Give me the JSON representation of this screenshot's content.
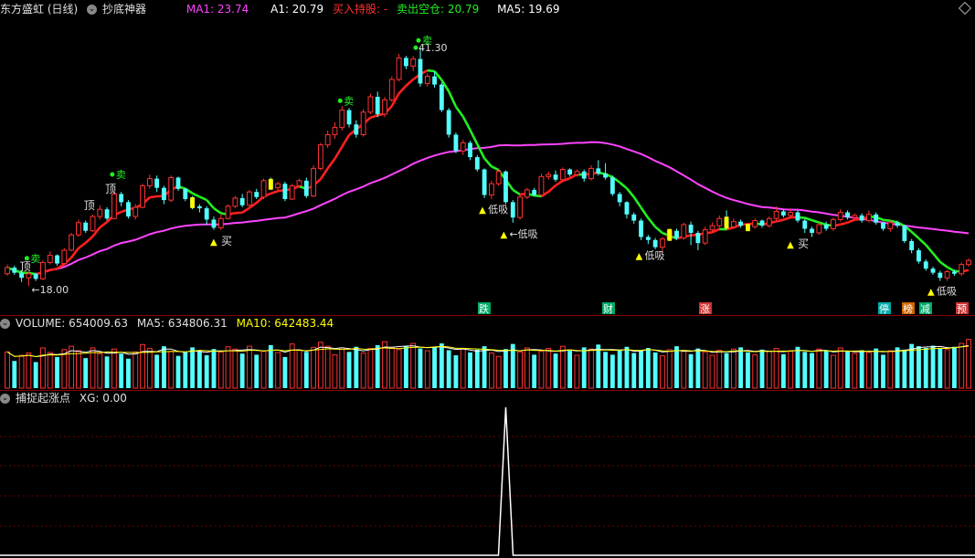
{
  "main_header": {
    "stock": "东方盛虹 (日线)",
    "indicator": "抄底神器",
    "ma1_label": "MA1: 23.74",
    "a1_label": "A1: 20.79",
    "buy_label": "买入持股: -",
    "sell_label": "卖出空仓: 20.79",
    "ma5_label": "MA5: 19.69"
  },
  "vol_header": {
    "volume": "VOLUME: 654009.63",
    "ma5": "MA5: 634806.31",
    "ma10": "MA10: 642483.44"
  },
  "xg_header": {
    "name": "捕捉起涨点",
    "xg": "XG: 0.00"
  },
  "colors": {
    "up": "#ff3232",
    "down": "#54ffff",
    "ma_magenta": "#ff44ff",
    "line_red": "#ff2020",
    "line_green": "#22ee22",
    "yellow": "#ffff00",
    "vol_ma5": "#ffffff",
    "vol_ma10": "#ffff00"
  },
  "labels": {
    "max": "41.30",
    "min": "18.00",
    "buy": "买",
    "sell": "卖",
    "top": "顶",
    "low_suck": "低吸"
  },
  "tags": [
    "跌",
    "财",
    "涨",
    "停",
    "榜",
    "减",
    "预"
  ],
  "chart_data": {
    "type": "candlestick",
    "price_range": [
      16.5,
      44
    ],
    "highest": 41.3,
    "lowest": 18.0,
    "candles": [
      [
        19.2,
        19.8,
        19.0,
        20.1
      ],
      [
        19.8,
        19.3,
        19.1,
        20.0
      ],
      [
        19.3,
        18.8,
        18.4,
        19.5
      ],
      [
        18.8,
        19.2,
        18.0,
        19.4
      ],
      [
        19.2,
        18.7,
        18.5,
        19.3
      ],
      [
        18.7,
        20.3,
        18.6,
        20.5
      ],
      [
        20.3,
        21.0,
        20.1,
        21.4
      ],
      [
        21.0,
        20.2,
        20.0,
        21.1
      ],
      [
        20.2,
        21.5,
        20.1,
        21.7
      ],
      [
        21.5,
        23.0,
        21.4,
        23.2
      ],
      [
        23.0,
        24.2,
        22.8,
        24.5
      ],
      [
        24.2,
        23.4,
        23.2,
        24.4
      ],
      [
        23.4,
        24.8,
        23.3,
        25.0
      ],
      [
        24.8,
        25.5,
        24.5,
        25.9
      ],
      [
        25.5,
        24.6,
        24.4,
        25.7
      ],
      [
        24.6,
        27.0,
        24.5,
        27.3
      ],
      [
        27.0,
        26.2,
        25.8,
        27.2
      ],
      [
        26.2,
        24.8,
        24.6,
        26.4
      ],
      [
        24.8,
        25.7,
        24.5,
        26.0
      ],
      [
        25.7,
        27.8,
        25.6,
        28.0
      ],
      [
        27.8,
        28.5,
        27.5,
        28.9
      ],
      [
        28.5,
        27.6,
        27.2,
        28.8
      ],
      [
        27.6,
        26.4,
        26.0,
        27.8
      ],
      [
        26.4,
        28.6,
        26.2,
        28.8
      ],
      [
        28.6,
        27.5,
        27.3,
        28.7
      ],
      [
        27.5,
        26.5,
        26.3,
        27.6
      ],
      [
        26.5,
        25.8,
        25.5,
        26.8
      ],
      [
        25.8,
        25.6,
        25.2,
        26.0
      ],
      [
        25.6,
        24.5,
        24.0,
        25.8
      ],
      [
        24.5,
        23.7,
        23.5,
        24.8
      ],
      [
        23.7,
        24.6,
        23.5,
        25.0
      ],
      [
        24.6,
        25.8,
        24.5,
        26.0
      ],
      [
        25.8,
        26.6,
        25.6,
        26.8
      ],
      [
        26.6,
        25.9,
        25.7,
        27.0
      ],
      [
        25.9,
        27.2,
        25.8,
        27.4
      ],
      [
        27.2,
        26.7,
        26.5,
        27.5
      ],
      [
        26.7,
        28.3,
        26.5,
        28.5
      ],
      [
        28.3,
        27.6,
        27.4,
        28.6
      ],
      [
        27.6,
        28.0,
        27.3,
        28.2
      ],
      [
        28.0,
        26.5,
        26.3,
        28.2
      ],
      [
        26.5,
        27.8,
        26.4,
        28.0
      ],
      [
        27.8,
        28.3,
        27.6,
        28.5
      ],
      [
        28.3,
        26.8,
        26.6,
        28.6
      ],
      [
        26.8,
        29.5,
        26.7,
        29.8
      ],
      [
        29.5,
        31.8,
        29.3,
        32.0
      ],
      [
        31.8,
        32.8,
        31.5,
        33.2
      ],
      [
        32.8,
        33.5,
        32.4,
        34.0
      ],
      [
        33.5,
        35.2,
        33.2,
        35.6
      ],
      [
        35.2,
        33.8,
        33.5,
        35.4
      ],
      [
        33.8,
        32.8,
        32.5,
        34.2
      ],
      [
        32.8,
        35.0,
        32.6,
        35.3
      ],
      [
        35.0,
        36.5,
        34.8,
        36.8
      ],
      [
        36.5,
        34.8,
        34.5,
        37.0
      ],
      [
        34.8,
        36.2,
        34.5,
        36.5
      ],
      [
        36.2,
        38.2,
        36.0,
        38.5
      ],
      [
        38.2,
        40.3,
        38.0,
        40.7
      ],
      [
        40.3,
        39.5,
        39.2,
        40.5
      ],
      [
        39.5,
        40.2,
        39.0,
        40.5
      ],
      [
        40.2,
        37.8,
        37.5,
        41.3
      ],
      [
        37.8,
        38.5,
        37.5,
        38.8
      ],
      [
        38.5,
        37.7,
        37.4,
        39.0
      ],
      [
        37.7,
        35.2,
        35.0,
        37.9
      ],
      [
        35.2,
        32.8,
        32.5,
        35.4
      ],
      [
        32.8,
        31.2,
        31.0,
        33.0
      ],
      [
        31.2,
        32.0,
        30.8,
        32.3
      ],
      [
        32.0,
        30.6,
        30.3,
        32.2
      ],
      [
        30.6,
        29.4,
        29.2,
        30.8
      ],
      [
        29.4,
        26.9,
        26.6,
        29.5
      ],
      [
        26.9,
        28.0,
        26.5,
        28.3
      ],
      [
        28.0,
        29.2,
        27.8,
        29.4
      ],
      [
        29.2,
        26.2,
        26.0,
        29.3
      ],
      [
        26.2,
        24.7,
        24.2,
        26.4
      ],
      [
        24.7,
        26.7,
        24.5,
        27.0
      ],
      [
        26.7,
        27.4,
        26.5,
        27.6
      ],
      [
        27.4,
        26.9,
        26.8,
        27.6
      ],
      [
        26.9,
        28.7,
        26.7,
        29.0
      ],
      [
        28.7,
        28.9,
        28.4,
        29.2
      ],
      [
        28.9,
        28.4,
        28.2,
        29.3
      ],
      [
        28.4,
        29.4,
        28.2,
        29.6
      ],
      [
        29.4,
        28.9,
        28.7,
        29.5
      ],
      [
        28.9,
        29.2,
        28.7,
        29.4
      ],
      [
        29.2,
        28.5,
        28.2,
        29.4
      ],
      [
        28.5,
        29.5,
        28.3,
        29.8
      ],
      [
        29.5,
        29.0,
        28.8,
        30.3
      ],
      [
        29.0,
        28.6,
        28.4,
        30.0
      ],
      [
        28.6,
        27.0,
        26.8,
        28.8
      ],
      [
        27.0,
        26.2,
        25.8,
        27.2
      ],
      [
        26.2,
        25.0,
        24.6,
        26.3
      ],
      [
        25.0,
        24.4,
        24.1,
        25.2
      ],
      [
        24.4,
        22.8,
        22.5,
        24.6
      ],
      [
        22.8,
        22.5,
        22.1,
        23.0
      ],
      [
        22.5,
        21.8,
        21.6,
        22.7
      ],
      [
        21.8,
        22.6,
        21.2,
        22.8
      ],
      [
        22.6,
        23.4,
        22.4,
        23.6
      ],
      [
        23.4,
        22.7,
        22.5,
        23.6
      ],
      [
        22.7,
        24.0,
        22.5,
        24.2
      ],
      [
        24.0,
        23.2,
        22.0,
        24.3
      ],
      [
        23.2,
        22.2,
        21.5,
        23.4
      ],
      [
        22.2,
        23.5,
        22.0,
        23.8
      ],
      [
        23.5,
        23.9,
        23.3,
        24.2
      ],
      [
        23.9,
        24.6,
        23.7,
        24.9
      ],
      [
        24.6,
        23.8,
        23.5,
        25.4
      ],
      [
        23.8,
        24.3,
        23.6,
        24.6
      ],
      [
        24.3,
        23.9,
        23.7,
        24.5
      ],
      [
        23.9,
        23.8,
        23.6,
        24.1
      ],
      [
        23.8,
        24.4,
        23.6,
        24.6
      ],
      [
        24.4,
        23.9,
        23.7,
        24.5
      ],
      [
        23.9,
        24.6,
        23.7,
        24.8
      ],
      [
        24.6,
        25.3,
        24.4,
        25.8
      ],
      [
        25.3,
        24.9,
        24.7,
        25.5
      ],
      [
        24.9,
        25.2,
        24.6,
        25.6
      ],
      [
        25.2,
        24.4,
        24.2,
        25.4
      ],
      [
        24.4,
        23.6,
        23.2,
        24.6
      ],
      [
        23.6,
        23.2,
        22.8,
        23.8
      ],
      [
        23.2,
        24.0,
        23.0,
        24.2
      ],
      [
        24.0,
        23.6,
        23.4,
        24.3
      ],
      [
        23.6,
        24.5,
        23.4,
        24.7
      ],
      [
        24.5,
        25.2,
        24.3,
        25.5
      ],
      [
        25.2,
        24.7,
        24.5,
        25.4
      ],
      [
        24.7,
        24.9,
        24.6,
        25.1
      ],
      [
        24.9,
        24.4,
        24.2,
        25.1
      ],
      [
        24.4,
        25.0,
        24.2,
        25.4
      ],
      [
        25.0,
        24.2,
        24.0,
        25.2
      ],
      [
        24.2,
        23.6,
        23.4,
        24.3
      ],
      [
        23.6,
        24.2,
        23.3,
        24.4
      ],
      [
        24.2,
        23.9,
        23.7,
        24.4
      ],
      [
        23.9,
        22.4,
        22.2,
        24.0
      ],
      [
        22.4,
        21.5,
        21.2,
        22.6
      ],
      [
        21.5,
        20.4,
        20.2,
        21.7
      ],
      [
        20.4,
        19.7,
        19.5,
        20.6
      ],
      [
        19.7,
        19.3,
        19.1,
        19.9
      ],
      [
        19.3,
        18.8,
        18.5,
        19.5
      ],
      [
        18.8,
        19.4,
        18.5,
        19.6
      ],
      [
        19.4,
        19.2,
        19.0,
        19.6
      ],
      [
        19.2,
        20.1,
        19.0,
        20.3
      ],
      [
        20.1,
        20.5,
        19.9,
        20.7
      ]
    ],
    "volume": [
      0.64,
      0.48,
      0.58,
      0.62,
      0.46,
      0.71,
      0.63,
      0.55,
      0.68,
      0.74,
      0.66,
      0.53,
      0.71,
      0.61,
      0.56,
      0.69,
      0.61,
      0.52,
      0.64,
      0.77,
      0.7,
      0.59,
      0.74,
      0.65,
      0.57,
      0.63,
      0.72,
      0.66,
      0.58,
      0.69,
      0.64,
      0.73,
      0.69,
      0.61,
      0.74,
      0.59,
      0.65,
      0.76,
      0.63,
      0.55,
      0.78,
      0.67,
      0.64,
      0.72,
      0.81,
      0.74,
      0.59,
      0.71,
      0.64,
      0.73,
      0.62,
      0.7,
      0.76,
      0.82,
      0.71,
      0.68,
      0.74,
      0.79,
      0.7,
      0.66,
      0.72,
      0.79,
      0.67,
      0.58,
      0.7,
      0.63,
      0.68,
      0.74,
      0.62,
      0.56,
      0.69,
      0.78,
      0.64,
      0.71,
      0.59,
      0.65,
      0.7,
      0.61,
      0.74,
      0.66,
      0.58,
      0.72,
      0.69,
      0.77,
      0.64,
      0.59,
      0.68,
      0.73,
      0.62,
      0.66,
      0.71,
      0.63,
      0.57,
      0.68,
      0.74,
      0.65,
      0.6,
      0.7,
      0.64,
      0.58,
      0.67,
      0.62,
      0.69,
      0.72,
      0.63,
      0.59,
      0.68,
      0.65,
      0.7,
      0.6,
      0.66,
      0.73,
      0.64,
      0.62,
      0.69,
      0.66,
      0.58,
      0.71,
      0.65,
      0.61,
      0.67,
      0.63,
      0.7,
      0.59,
      0.66,
      0.72,
      0.68,
      0.78,
      0.74,
      0.71,
      0.75,
      0.7,
      0.68,
      0.73,
      0.79,
      0.86
    ],
    "volume_up": [
      1,
      0,
      1,
      1,
      0,
      1,
      1,
      0,
      1,
      1,
      1,
      0,
      1,
      1,
      0,
      1,
      0,
      0,
      1,
      1,
      1,
      0,
      0,
      1,
      0,
      0,
      0,
      0,
      0,
      0,
      1,
      1,
      1,
      0,
      1,
      0,
      1,
      0,
      1,
      0,
      1,
      1,
      0,
      1,
      1,
      1,
      1,
      1,
      0,
      0,
      1,
      1,
      0,
      1,
      1,
      1,
      0,
      1,
      0,
      1,
      0,
      0,
      0,
      0,
      1,
      0,
      0,
      0,
      1,
      1,
      0,
      0,
      1,
      1,
      0,
      1,
      1,
      0,
      1,
      0,
      1,
      0,
      1,
      0,
      0,
      0,
      0,
      0,
      0,
      0,
      0,
      0,
      1,
      1,
      0,
      1,
      0,
      0,
      1,
      1,
      1,
      0,
      1,
      0,
      0,
      1,
      0,
      1,
      1,
      0,
      1,
      0,
      0,
      0,
      1,
      0,
      1,
      1,
      0,
      1,
      0,
      1,
      0,
      0,
      1,
      0,
      0,
      0,
      0,
      0,
      0,
      0,
      1,
      0,
      1,
      1
    ],
    "xg_peak_index": 70
  }
}
